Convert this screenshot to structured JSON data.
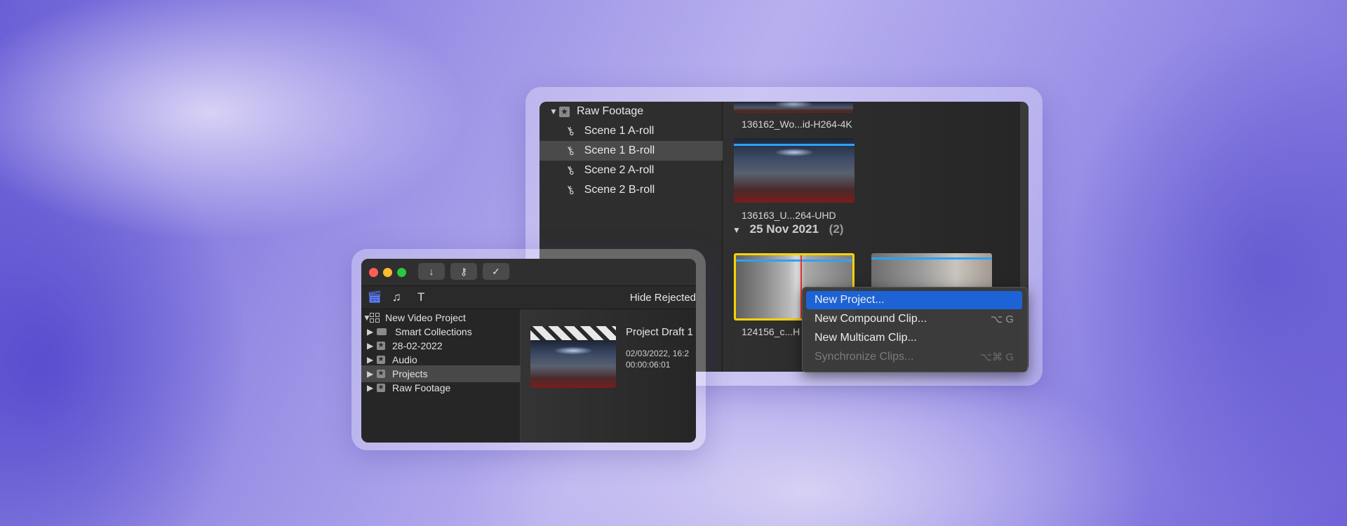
{
  "big_window": {
    "sidebar": {
      "root_label": "Raw Footage",
      "items": [
        {
          "label": "Scene 1 A-roll"
        },
        {
          "label": "Scene 1 B-roll"
        },
        {
          "label": "Scene 2 A-roll"
        },
        {
          "label": "Scene 2 B-roll"
        }
      ]
    },
    "browser": {
      "clips_top": [
        {
          "label": "136162_Wo...id-H264-4K"
        },
        {
          "label": "136163_U...264-UHD"
        }
      ],
      "date_group": {
        "date": "25 Nov 2021",
        "count": "(2)"
      },
      "clips_bottom": [
        {
          "label": "124156_c...H"
        }
      ]
    }
  },
  "context_menu": {
    "items": [
      {
        "label": "New Project...",
        "shortcut": "",
        "state": "highlighted"
      },
      {
        "label": "New Compound Clip...",
        "shortcut": "⌥ G",
        "state": "normal"
      },
      {
        "label": "New Multicam Clip...",
        "shortcut": "",
        "state": "normal"
      },
      {
        "label": "Synchronize Clips...",
        "shortcut": "⌥⌘ G",
        "state": "disabled"
      }
    ],
    "highlight_color": "#1d63d6"
  },
  "small_window": {
    "toolbar_buttons": [
      {
        "icon": "import-arrow-icon",
        "glyph": "↓"
      },
      {
        "icon": "key-icon",
        "glyph": "⚷"
      },
      {
        "icon": "checkmark-icon",
        "glyph": "✓"
      }
    ],
    "hide_rejected_label": "Hide Rejected",
    "library": {
      "root_label": "New Video Project",
      "items": [
        {
          "label": "Smart Collections"
        },
        {
          "label": "28-02-2022"
        },
        {
          "label": "Audio"
        },
        {
          "label": "Projects"
        },
        {
          "label": "Raw Footage"
        }
      ]
    },
    "project": {
      "title": "Project Draft 1",
      "date": "02/03/2022, 16:2",
      "duration": "00:00:06:01"
    }
  },
  "colors": {
    "traffic_close": "#ff5f57",
    "traffic_minimize": "#febc2e",
    "traffic_zoom": "#28c840",
    "selection_border": "#f5d400",
    "playhead": "#e0362b"
  }
}
